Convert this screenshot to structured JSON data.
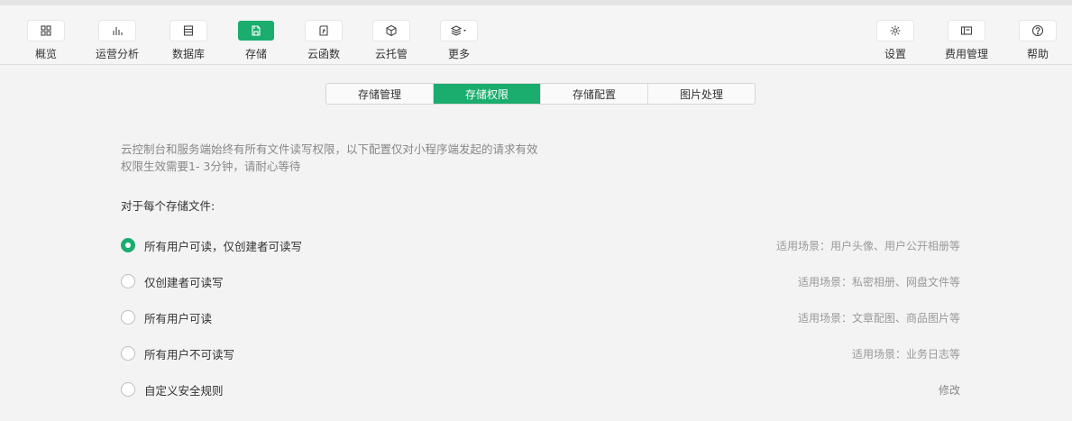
{
  "toolbar": {
    "left": [
      {
        "label": "概览",
        "icon": "grid-icon"
      },
      {
        "label": "运营分析",
        "icon": "bar-chart-icon"
      },
      {
        "label": "数据库",
        "icon": "database-icon"
      },
      {
        "label": "存储",
        "icon": "storage-icon",
        "active": true
      },
      {
        "label": "云函数",
        "icon": "function-icon"
      },
      {
        "label": "云托管",
        "icon": "cube-icon"
      },
      {
        "label": "更多",
        "icon": "layers-icon"
      }
    ],
    "right": [
      {
        "label": "设置",
        "icon": "gear-icon"
      },
      {
        "label": "费用管理",
        "icon": "wallet-icon"
      },
      {
        "label": "帮助",
        "icon": "help-icon"
      }
    ]
  },
  "tabs": [
    {
      "label": "存储管理"
    },
    {
      "label": "存储权限",
      "active": true
    },
    {
      "label": "存储配置"
    },
    {
      "label": "图片处理"
    }
  ],
  "notice": {
    "line1": "云控制台和服务端始终有所有文件读写权限，以下配置仅对小程序端发起的请求有效",
    "line2": "权限生效需要1- 3分钟，请耐心等待"
  },
  "section_title": "对于每个存储文件:",
  "options": [
    {
      "label": "所有用户可读，仅创建者可读写",
      "hint": "适用场景：用户头像、用户公开相册等",
      "checked": true
    },
    {
      "label": "仅创建者可读写",
      "hint": "适用场景：私密相册、网盘文件等",
      "checked": false
    },
    {
      "label": "所有用户可读",
      "hint": "适用场景：文章配图、商品图片等",
      "checked": false
    },
    {
      "label": "所有用户不可读写",
      "hint": "适用场景：业务日志等",
      "checked": false
    },
    {
      "label": "自定义安全规则",
      "hint": "修改",
      "checked": false
    }
  ],
  "colors": {
    "accent": "#1aad6e"
  }
}
